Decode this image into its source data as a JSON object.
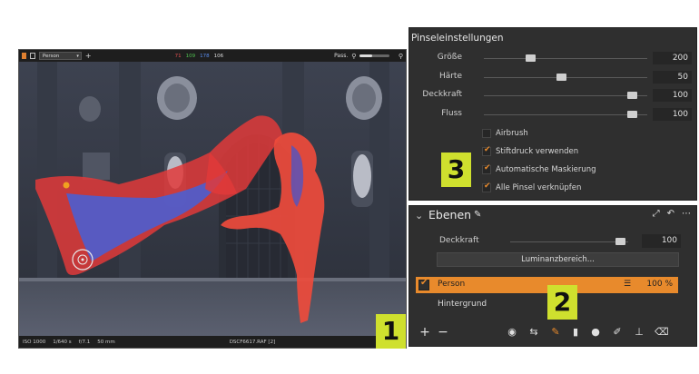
{
  "viewer": {
    "toolbar": {
      "mask_select": "Person",
      "r": "71",
      "g": "109",
      "b": "178",
      "l": "106",
      "pass_label": "Pass."
    },
    "status": {
      "iso": "ISO 1000",
      "shutter": "1/640 s",
      "aperture": "f/7.1",
      "focal": "50 mm",
      "filename": "DSCF6617.RAF [2]"
    }
  },
  "brush_settings": {
    "title": "Pinseleinstellungen",
    "sliders": [
      {
        "label": "Größe",
        "value": "200",
        "fraction": 0.29
      },
      {
        "label": "Härte",
        "value": "50",
        "fraction": 0.47
      },
      {
        "label": "Deckkraft",
        "value": "100",
        "fraction": 0.95
      },
      {
        "label": "Fluss",
        "value": "100",
        "fraction": 0.95
      }
    ],
    "checkboxes": [
      {
        "label": "Airbrush",
        "checked": false
      },
      {
        "label": "Stiftdruck verwenden",
        "checked": true
      },
      {
        "label": "Automatische Maskierung",
        "checked": true
      },
      {
        "label": "Alle Pinsel verknüpfen",
        "checked": true
      }
    ]
  },
  "layers": {
    "title": "Ebenen",
    "opacity_label": "Deckkraft",
    "opacity_value": "100",
    "luminance_button": "Luminanzbereich...",
    "items": [
      {
        "name": "Person",
        "opacity": "100 %",
        "checked": true,
        "selected": true
      },
      {
        "name": "Hintergrund",
        "selected": false
      }
    ]
  },
  "badges": [
    "1",
    "2",
    "3"
  ],
  "colors": {
    "accent": "#e88a2c",
    "badge": "#cfe02e",
    "panel": "#2f2f2f",
    "mask_red": "#e03a3a"
  },
  "icons": {
    "add": "plus-icon",
    "remove": "minus-icon",
    "eye": "eye-icon",
    "swap": "swap-icon",
    "brush": "brush-icon",
    "gradient": "gradient-icon",
    "radial": "radial-icon",
    "eraser": "eraser-icon",
    "stamp": "stamp-icon",
    "draw": "draw-mask-icon"
  }
}
